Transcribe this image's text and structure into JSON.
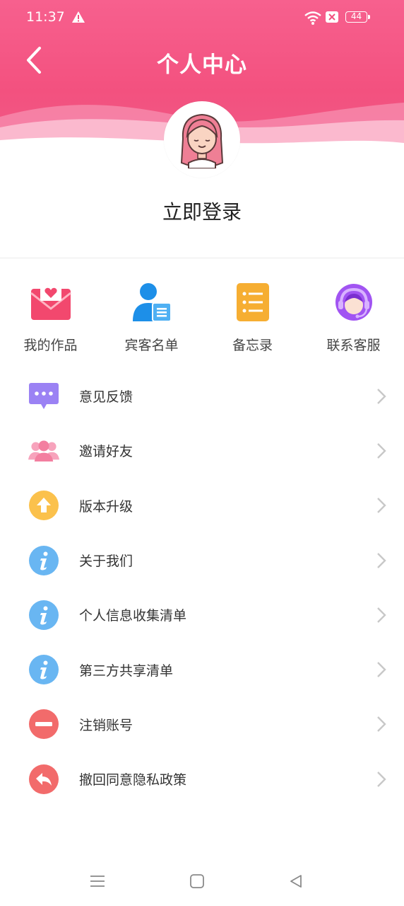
{
  "status_bar": {
    "time": "11:37",
    "battery": "44"
  },
  "header": {
    "title": "个人中心"
  },
  "profile": {
    "login_label": "立即登录"
  },
  "quick_actions": [
    {
      "label": "我的作品",
      "icon": "heart-envelope-icon",
      "color": "#f2486e"
    },
    {
      "label": "宾客名单",
      "icon": "guest-list-icon",
      "color": "#1d8fe8"
    },
    {
      "label": "备忘录",
      "icon": "memo-icon",
      "color": "#f6ae32"
    },
    {
      "label": "联系客服",
      "icon": "customer-service-icon",
      "color": "#a154f2"
    }
  ],
  "menu": [
    {
      "label": "意见反馈",
      "icon": "feedback-chat-icon",
      "color": "#9b82f4"
    },
    {
      "label": "邀请好友",
      "icon": "invite-friends-icon",
      "color": "#f37fa0"
    },
    {
      "label": "版本升级",
      "icon": "upgrade-arrow-icon",
      "color": "#fbc14c"
    },
    {
      "label": "关于我们",
      "icon": "info-icon",
      "color": "#69b6f2"
    },
    {
      "label": "个人信息收集清单",
      "icon": "info-icon",
      "color": "#69b6f2"
    },
    {
      "label": "第三方共享清单",
      "icon": "info-icon",
      "color": "#69b6f2"
    },
    {
      "label": "注销账号",
      "icon": "minus-circle-icon",
      "color": "#f26b6b"
    },
    {
      "label": "撤回同意隐私政策",
      "icon": "revoke-arrow-icon",
      "color": "#f26b6b"
    }
  ],
  "colors": {
    "header_pink": "#f3517f",
    "chevron": "#c8c8c8"
  }
}
